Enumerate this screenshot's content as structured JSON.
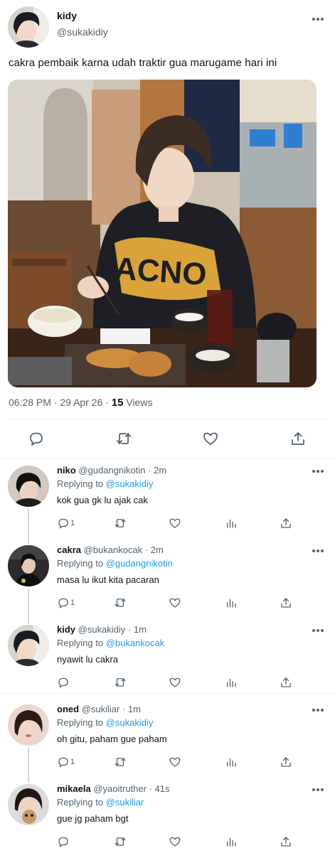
{
  "main_tweet": {
    "author_name": "kidy",
    "author_handle": "@sukakidiy",
    "text": "cakra pembaik karna udah traktir gua marugame hari ini",
    "time": "06:28 PM",
    "date": "29 Apr 26",
    "views_count": "15",
    "views_label": "Views"
  },
  "replies": [
    {
      "name": "niko",
      "handle": "@gudangnikotin",
      "time": "2m",
      "replying_prefix": "Replying to",
      "replying_to": "@sukakidiy",
      "text": "kok gua gk lu ajak cak",
      "reply_count": "1"
    },
    {
      "name": "cakra",
      "handle": "@bukankocak",
      "time": "2m",
      "replying_prefix": "Replying to",
      "replying_to": "@gudangnikotin",
      "text": "masa lu ikut kita pacaran",
      "reply_count": "1"
    },
    {
      "name": "kidy",
      "handle": "@sukakidiy",
      "time": "1m",
      "replying_prefix": "Replying to",
      "replying_to": "@bukankocak",
      "text": "nyawit lu cakra",
      "reply_count": ""
    },
    {
      "name": "oned",
      "handle": "@sukiliar",
      "time": "1m",
      "replying_prefix": "Replying to",
      "replying_to": "@sukakidiy",
      "text": "oh gitu, paham gue paham",
      "reply_count": "1"
    },
    {
      "name": "mikaela",
      "handle": "@yaoitruther",
      "time": "41s",
      "replying_prefix": "Replying to",
      "replying_to": "@sukiliar",
      "text": "gue jg paham bgt",
      "reply_count": ""
    }
  ],
  "photo_text": "ACNO",
  "icons": {
    "more": "more-dots-icon",
    "reply": "speech-bubble-icon",
    "retweet": "retweet-arrows-icon",
    "like": "heart-icon",
    "analytics": "bar-chart-icon",
    "share": "share-upload-icon"
  },
  "colors": {
    "link": "#1d9bf0",
    "secondary_text": "#536471",
    "divider": "#eff3f4",
    "thread_line": "#cfd9de"
  }
}
